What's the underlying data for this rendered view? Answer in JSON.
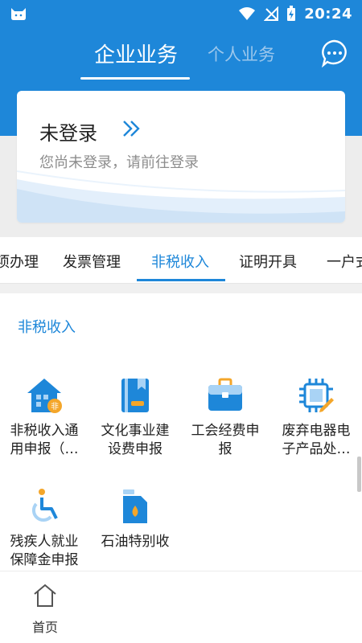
{
  "status_bar": {
    "time": "20:24"
  },
  "header": {
    "tab_enterprise": "企业业务",
    "tab_personal": "个人业务"
  },
  "login_card": {
    "title": "未登录",
    "subtitle": "您尚未登录，请前往登录"
  },
  "category_tabs": [
    {
      "label": "项办理"
    },
    {
      "label": "发票管理"
    },
    {
      "label": "非税收入",
      "active": true
    },
    {
      "label": "证明开具"
    },
    {
      "label": "一户式"
    }
  ],
  "section": {
    "title": "非税收入",
    "items": [
      {
        "label": "非税收入通用申报（…",
        "icon": "house-tax-icon"
      },
      {
        "label": "文化事业建设费申报",
        "icon": "book-icon"
      },
      {
        "label": "工会经费申报",
        "icon": "briefcase-icon"
      },
      {
        "label": "废弃电器电子产品处…",
        "icon": "chip-icon"
      },
      {
        "label": "残疾人就业保障金申报",
        "icon": "wheelchair-icon"
      },
      {
        "label": "石油特别收",
        "icon": "oil-can-icon"
      }
    ]
  },
  "bottom_nav": {
    "home": "首页"
  },
  "colors": {
    "primary": "#1e87d9",
    "icon_light": "#a9d3f5",
    "accent_orange": "#f4a62a"
  }
}
